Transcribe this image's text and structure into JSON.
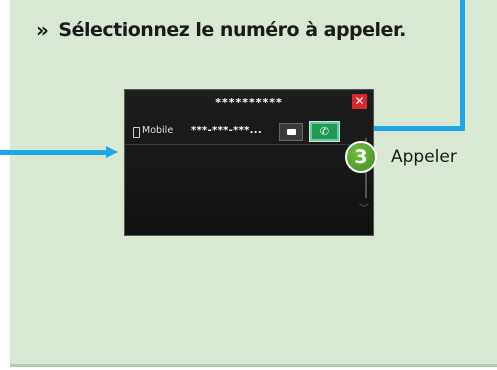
{
  "instruction": {
    "chevron": "»",
    "text": "Sélectionnez le numéro à appeler."
  },
  "screen": {
    "title": "**********",
    "close_glyph": "✕",
    "contact_row": {
      "phone_type": "Mobile",
      "number": "***-***-***..."
    },
    "call_glyph": "✆",
    "scroll_glyph": "﹀"
  },
  "callout": {
    "step_number": "3",
    "step_label": "Appeler"
  },
  "colors": {
    "panel_bg": "#d9e8d3",
    "callout_blue": "#1ea7e8",
    "call_green": "#1f9a52",
    "close_red": "#e0262c",
    "step_green": "#4fa32b"
  },
  "icons": [
    "chevron-double-right-icon",
    "close-icon",
    "mobile-phone-icon",
    "message-icon",
    "phone-call-icon",
    "scroll-down-icon"
  ]
}
